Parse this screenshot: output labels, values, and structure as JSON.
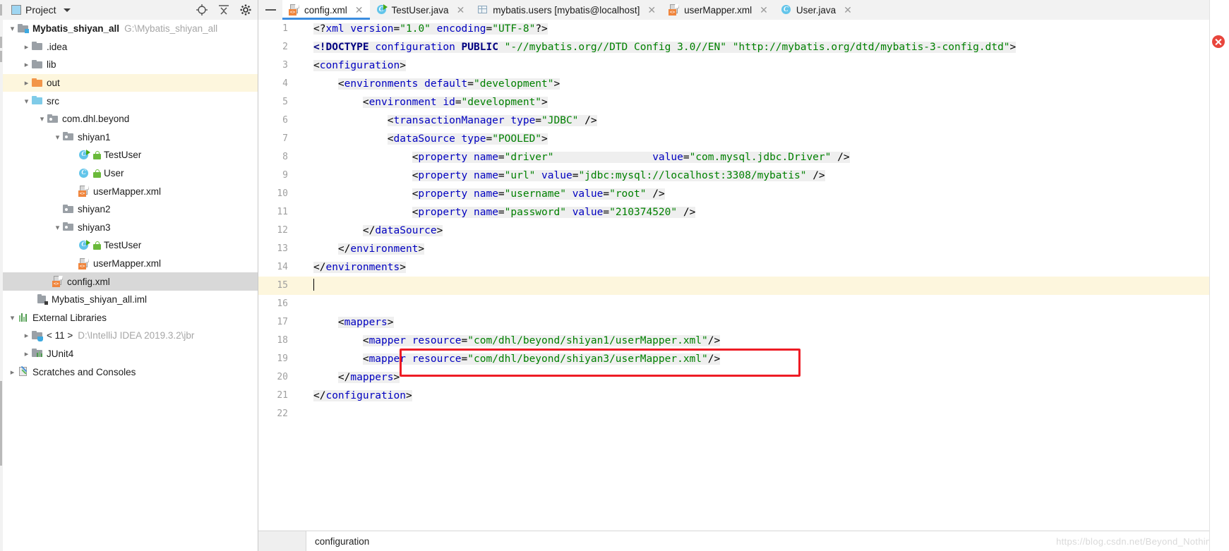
{
  "project_panel": {
    "title": "Project",
    "icons": [
      "project-window-icon",
      "locate-icon",
      "collapse-all-icon",
      "settings-gear-icon",
      "hide-icon"
    ],
    "tree": [
      {
        "indent": 0,
        "arrow": "v",
        "icon": "folder-module",
        "label": "Mybatis_shiyan_all",
        "bold": true,
        "sub": "G:\\Mybatis_shiyan_all",
        "state": "normal"
      },
      {
        "indent": 1,
        "arrow": ">",
        "icon": "folder-gray",
        "label": ".idea",
        "bold": false,
        "sub": "",
        "state": "normal"
      },
      {
        "indent": 1,
        "arrow": ">",
        "icon": "folder-gray",
        "label": "lib",
        "bold": false,
        "sub": "",
        "state": "normal"
      },
      {
        "indent": 1,
        "arrow": ">",
        "icon": "folder-orange",
        "label": "out",
        "bold": false,
        "sub": "",
        "state": "highlight"
      },
      {
        "indent": 1,
        "arrow": "v",
        "icon": "folder-source",
        "label": "src",
        "bold": false,
        "sub": "",
        "state": "normal"
      },
      {
        "indent": 2,
        "arrow": "v",
        "icon": "folder-package",
        "label": "com.dhl.beyond",
        "bold": false,
        "sub": "",
        "state": "normal"
      },
      {
        "indent": 3,
        "arrow": "v",
        "icon": "folder-package",
        "label": "shiyan1",
        "bold": false,
        "sub": "",
        "state": "normal"
      },
      {
        "indent": 4,
        "arrow": "",
        "icon": "java-class-runnable",
        "label": "TestUser",
        "bold": false,
        "sub": "",
        "state": "normal"
      },
      {
        "indent": 4,
        "arrow": "",
        "icon": "java-class",
        "label": "User",
        "bold": false,
        "sub": "",
        "state": "normal"
      },
      {
        "indent": 4,
        "arrow": "",
        "icon": "xml-file",
        "label": "userMapper.xml",
        "bold": false,
        "sub": "",
        "state": "normal"
      },
      {
        "indent": 3,
        "arrow": "",
        "icon": "folder-package",
        "label": "shiyan2",
        "bold": false,
        "sub": "",
        "state": "normal"
      },
      {
        "indent": 3,
        "arrow": "v",
        "icon": "folder-package",
        "label": "shiyan3",
        "bold": false,
        "sub": "",
        "state": "normal"
      },
      {
        "indent": 4,
        "arrow": "",
        "icon": "java-class-runnable",
        "label": "TestUser",
        "bold": false,
        "sub": "",
        "state": "normal"
      },
      {
        "indent": 4,
        "arrow": "",
        "icon": "xml-file",
        "label": "userMapper.xml",
        "bold": false,
        "sub": "",
        "state": "normal"
      },
      {
        "indent": 2,
        "arrow": "",
        "icon": "xml-file",
        "label": "config.xml",
        "bold": false,
        "sub": "",
        "state": "selected"
      },
      {
        "indent": 1,
        "arrow": "",
        "icon": "iml-file",
        "label": "Mybatis_shiyan_all.iml",
        "bold": false,
        "sub": "",
        "state": "normal"
      },
      {
        "indent": 0,
        "arrow": "v",
        "icon": "external-libraries",
        "label": "External Libraries",
        "bold": false,
        "sub": "",
        "state": "normal"
      },
      {
        "indent": 1,
        "arrow": ">",
        "icon": "jdk",
        "label": "< 11 >",
        "bold": false,
        "sub": "D:\\IntelliJ IDEA 2019.3.2\\jbr",
        "state": "normal"
      },
      {
        "indent": 1,
        "arrow": ">",
        "icon": "junit-library",
        "label": "JUnit4",
        "bold": false,
        "sub": "",
        "state": "normal"
      },
      {
        "indent": 0,
        "arrow": ">",
        "icon": "scratches",
        "label": "Scratches and Consoles",
        "bold": false,
        "sub": "",
        "state": "normal"
      }
    ]
  },
  "tabs": [
    {
      "label": "config.xml",
      "icon": "xml-file",
      "active": true,
      "closable": true
    },
    {
      "label": "TestUser.java",
      "icon": "java-class-runnable",
      "active": false,
      "closable": true
    },
    {
      "label": "mybatis.users [mybatis@localhost]",
      "icon": "database-table",
      "active": false,
      "closable": true
    },
    {
      "label": "userMapper.xml",
      "icon": "xml-file",
      "active": false,
      "closable": true
    },
    {
      "label": "User.java",
      "icon": "java-class",
      "active": false,
      "closable": true
    }
  ],
  "editor": {
    "filename": "config.xml",
    "current_line": 15,
    "gutter_numbers": [
      "1",
      "2",
      "3",
      "4",
      "5",
      "6",
      "7",
      "8",
      "9",
      "10",
      "11",
      "12",
      "13",
      "14",
      "15",
      "16",
      "17",
      "18",
      "19",
      "20",
      "21",
      "22"
    ],
    "code_lines": [
      "<?xml version=\"1.0\" encoding=\"UTF-8\"?>",
      "<!DOCTYPE configuration PUBLIC \"-//mybatis.org//DTD Config 3.0//EN\" \"http://mybatis.org/dtd/mybatis-3-config.dtd\">",
      "<configuration>",
      "    <environments default=\"development\">",
      "        <environment id=\"development\">",
      "            <transactionManager type=\"JDBC\" />",
      "            <dataSource type=\"POOLED\">",
      "                <property name=\"driver\"                value=\"com.mysql.jdbc.Driver\" />",
      "                <property name=\"url\" value=\"jdbc:mysql://localhost:3308/mybatis\" />",
      "                <property name=\"username\" value=\"root\" />",
      "                <property name=\"password\" value=\"210374520\" />",
      "        </dataSource>",
      "    </environment>",
      "</environments>",
      "",
      "",
      "    <mappers>",
      "        <mapper resource=\"com/dhl/beyond/shiyan1/userMapper.xml\"/>",
      "        <mapper resource=\"com/dhl/beyond/shiyan3/userMapper.xml\"/>",
      "    </mappers>",
      "</configuration>",
      ""
    ],
    "annotation": {
      "type": "red-rectangle",
      "around_line": 19,
      "color": "#ee1c25"
    },
    "bulb_line": 14,
    "breadcrumb": "configuration",
    "error_marker": "error-icon"
  },
  "watermark": "https://blog.csdn.net/Beyond_Nothing",
  "colors": {
    "tag": "#0000c0",
    "value": "#008000",
    "doctype": "#000080",
    "annotation": "#ee1c25",
    "selection": "#d8d8d8",
    "current_line": "#fdf6dd",
    "tab_underline": "#3c8de0"
  }
}
